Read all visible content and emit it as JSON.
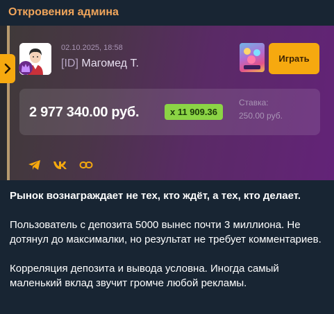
{
  "channel": {
    "name": "Откровения админа"
  },
  "card": {
    "date": "02.10.2025, 18:58",
    "user_id": "[ID]",
    "user_name": "Магомед Т.",
    "play_label": "Играть",
    "amount": "2 977 340.00 руб.",
    "multiplier": "x 11 909.36",
    "stake_label": "Ставка:",
    "stake_value": "250.00 руб.",
    "share_icons": [
      "telegram-icon",
      "vk-icon",
      "link-icon"
    ],
    "colors": {
      "accent": "#f6a90f",
      "multiplier": "#8bd445",
      "channel": "#f0a55b"
    }
  },
  "post": {
    "headline": "Рынок вознаграждает не тех, кто ждёт, а тех, кто делает.",
    "paragraph1": "Пользователь с депозита 5000 вынес почти 3 миллиона. Не дотянул до максималки, но результат не требует комментариев.",
    "paragraph2": "Корреляция депозита и вывода условна. Иногда самый маленький вклад звучит громче любой рекламы."
  }
}
